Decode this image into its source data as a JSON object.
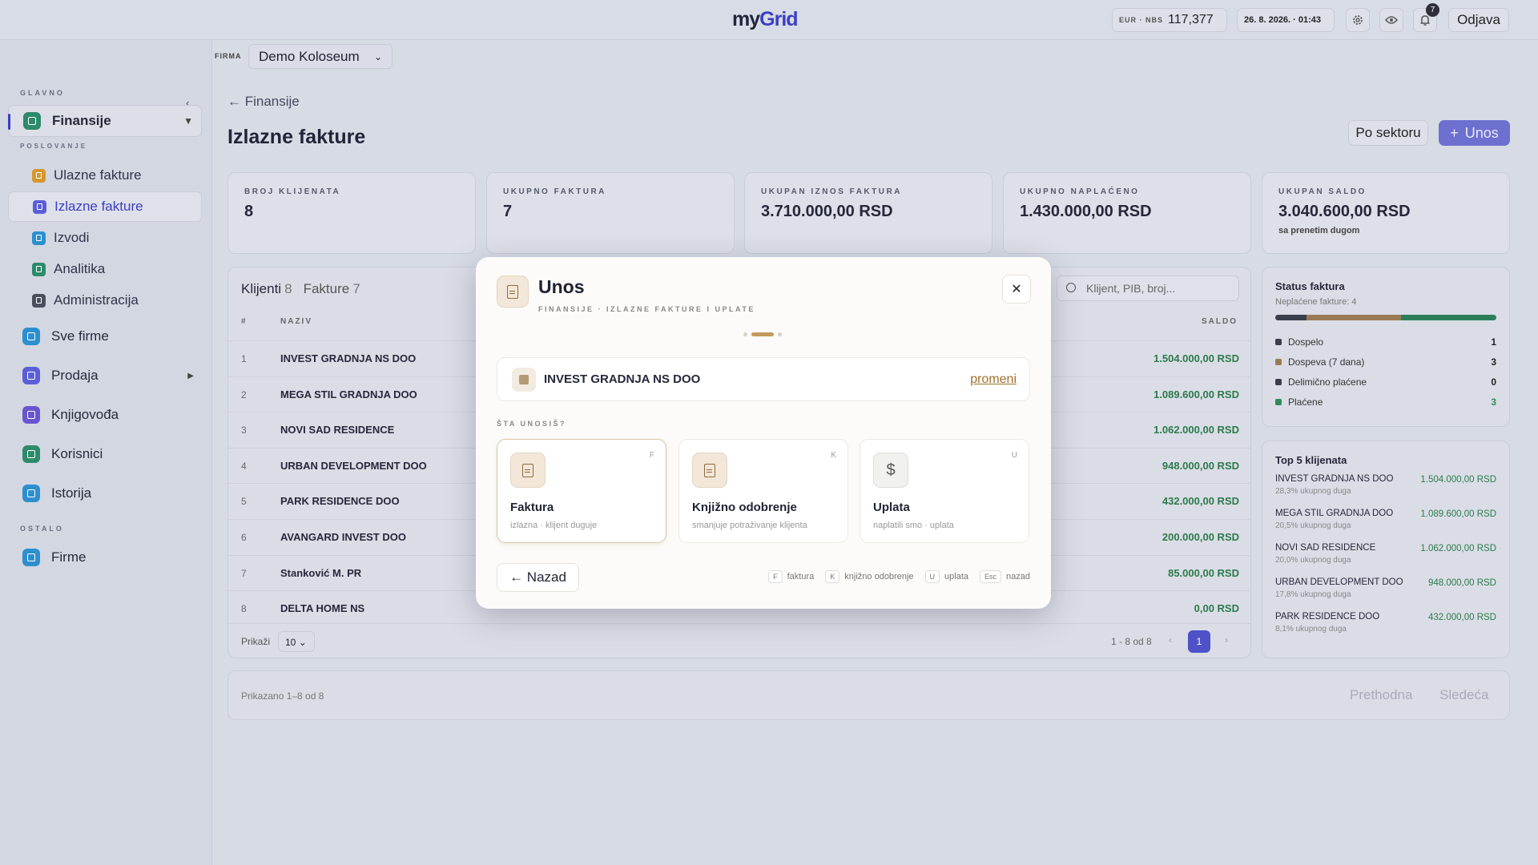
{
  "header": {
    "logo_my": "my",
    "logo_grid": "Grid",
    "rate_label": "EUR · NBS",
    "rate_value": "117,377",
    "datetime": "26. 8. 2026. · 01:43",
    "notifications": "7",
    "logout": "Odjava"
  },
  "sidebar": {
    "section_main": "GLAVNO",
    "section_business": "POSLOVANJE",
    "section_other": "OSTALO",
    "finansije": "Finansije",
    "sub_items": [
      {
        "label": "Ulazne fakture",
        "color": "#d4982e"
      },
      {
        "label": "Izlazne fakture",
        "color": "#5b5fd6"
      },
      {
        "label": "Izvodi",
        "color": "#2d8fcf"
      },
      {
        "label": "Analitika",
        "color": "#2d8a6a"
      },
      {
        "label": "Administracija",
        "color": "#4a4f5c"
      }
    ],
    "items": [
      {
        "label": "Sve firme",
        "color": "#2d8fcf"
      },
      {
        "label": "Prodaja",
        "color": "#5b5fd6"
      },
      {
        "label": "Knjigovođa",
        "color": "#6a55d0"
      },
      {
        "label": "Korisnici",
        "color": "#2d8a6a"
      },
      {
        "label": "Istorija",
        "color": "#2d8fcf"
      }
    ],
    "firme": "Firme"
  },
  "topline": {
    "firma_label": "FIRMA",
    "firma_value": "Demo Koloseum"
  },
  "page": {
    "breadcrumb": "← Finansije",
    "title": "Izlazne fakture",
    "btn_sector": "Po sektoru",
    "btn_unos": "Unos"
  },
  "stats": [
    {
      "label": "BROJ KLIJENATA",
      "value": "8",
      "sub": ""
    },
    {
      "label": "UKUPNO FAKTURA",
      "value": "7",
      "sub": ""
    },
    {
      "label": "UKUPAN IZNOS FAKTURA",
      "value": "3.710.000,00 RSD",
      "sub": ""
    },
    {
      "label": "UKUPNO NAPLAĆENO",
      "value": "1.430.000,00 RSD",
      "sub": ""
    },
    {
      "label": "UKUPAN SALDO",
      "value": "3.040.600,00 RSD",
      "sub": "sa prenetim dugom"
    }
  ],
  "table": {
    "tab_clients": "Klijenti",
    "tab_clients_count": "8",
    "tab_invoices": "Fakture",
    "tab_invoices_count": "7",
    "search_placeholder": "Klijent, PIB, broj...",
    "col_no": "#",
    "col_name": "NAZIV",
    "col_balance": "SALDO",
    "rows": [
      {
        "no": "1",
        "name": "INVEST GRADNJA NS DOO",
        "balance": "1.504.000,00 RSD"
      },
      {
        "no": "2",
        "name": "MEGA STIL GRADNJA DOO",
        "balance": "1.089.600,00 RSD"
      },
      {
        "no": "3",
        "name": "NOVI SAD RESIDENCE",
        "balance": "1.062.000,00 RSD"
      },
      {
        "no": "4",
        "name": "URBAN DEVELOPMENT DOO",
        "balance": "948.000,00 RSD"
      },
      {
        "no": "5",
        "name": "PARK RESIDENCE DOO",
        "balance": "432.000,00 RSD"
      },
      {
        "no": "6",
        "name": "AVANGARD INVEST DOO",
        "balance": "200.000,00 RSD"
      },
      {
        "no": "7",
        "name": "Stanković M. PR",
        "balance": "85.000,00 RSD"
      },
      {
        "no": "8",
        "name": "DELTA HOME NS",
        "balance": "0,00 RSD"
      }
    ],
    "show_label": "Prikaži",
    "show_value": "10",
    "range": "1 - 8 od 8",
    "page": "1"
  },
  "status": {
    "title": "Status faktura",
    "sub": "Neplaćene fakture: 4",
    "items": [
      {
        "label": "Dospelo",
        "value": "1",
        "color": "#3a3d4a"
      },
      {
        "label": "Dospeva (7 dana)",
        "value": "3",
        "color": "#9a7a55"
      },
      {
        "label": "Delimično plaćene",
        "value": "0",
        "color": "#3a3d4a"
      },
      {
        "label": "Plaćene",
        "value": "3",
        "color": "#2e8a5a"
      }
    ]
  },
  "top5": {
    "title": "Top 5 klijenata",
    "items": [
      {
        "name": "INVEST GRADNJA NS DOO",
        "value": "1.504.000,00 RSD",
        "share": "28,3% ukupnog duga"
      },
      {
        "name": "MEGA STIL GRADNJA DOO",
        "value": "1.089.600,00 RSD",
        "share": "20,5% ukupnog duga"
      },
      {
        "name": "NOVI SAD RESIDENCE",
        "value": "1.062.000,00 RSD",
        "share": "20,0% ukupnog duga"
      },
      {
        "name": "URBAN DEVELOPMENT DOO",
        "value": "948.000,00 RSD",
        "share": "17,8% ukupnog duga"
      },
      {
        "name": "PARK RESIDENCE DOO",
        "value": "432.000,00 RSD",
        "share": "8,1% ukupnog duga"
      }
    ]
  },
  "footer": {
    "shown": "Prikazano 1–8 od 8",
    "prev": "Prethodna",
    "next": "Sledeća"
  },
  "modal": {
    "title": "Unos",
    "subtitle": "FINANSIJE · IZLAZNE FAKTURE I UPLATE",
    "client": "INVEST GRADNJA NS DOO",
    "change": "promeni",
    "question": "ŠTA UNOSIŠ?",
    "options": [
      {
        "title": "Faktura",
        "desc": "izlazna · klijent duguje",
        "key": "F"
      },
      {
        "title": "Knjižno odobrenje",
        "desc": "smanjuje potraživanje klijenta",
        "key": "K"
      },
      {
        "title": "Uplata",
        "desc": "naplatili smo · uplata",
        "key": "U"
      }
    ],
    "back": "← Nazad",
    "hints": [
      {
        "key": "F",
        "label": "faktura"
      },
      {
        "key": "K",
        "label": "knjižno odobrenje"
      },
      {
        "key": "U",
        "label": "uplata"
      },
      {
        "key": "Esc",
        "label": "nazad"
      }
    ]
  }
}
